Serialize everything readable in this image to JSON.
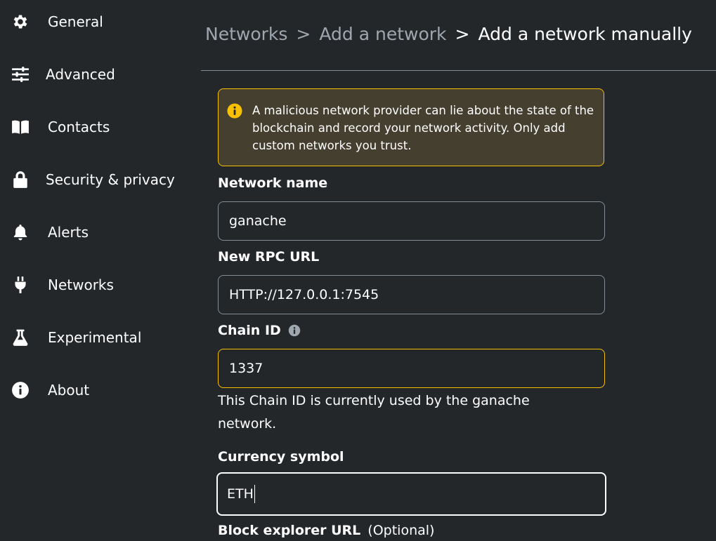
{
  "sidebar": {
    "items": [
      {
        "label": "General",
        "icon": "gear-icon"
      },
      {
        "label": "Advanced",
        "icon": "sliders-icon"
      },
      {
        "label": "Contacts",
        "icon": "book-icon"
      },
      {
        "label": "Security & privacy",
        "icon": "lock-icon"
      },
      {
        "label": "Alerts",
        "icon": "bell-icon"
      },
      {
        "label": "Networks",
        "icon": "plug-icon"
      },
      {
        "label": "Experimental",
        "icon": "flask-icon"
      },
      {
        "label": "About",
        "icon": "info-icon"
      }
    ]
  },
  "header": {
    "breadcrumb": {
      "networks": "Networks",
      "sep1": ">",
      "add_network": "Add a network",
      "sep2": ">",
      "current": "Add a network manually"
    }
  },
  "warning": {
    "text": "A malicious network provider can lie about the state of the blockchain and record your network activity. Only add custom networks you trust."
  },
  "form": {
    "network_name": {
      "label": "Network name",
      "value": "ganache"
    },
    "rpc_url": {
      "label": "New RPC URL",
      "value": "HTTP://127.0.0.1:7545"
    },
    "chain_id": {
      "label": "Chain ID",
      "value": "1337",
      "helper": "This Chain ID is currently used by the ganache network."
    },
    "currency_symbol": {
      "label": "Currency symbol",
      "value": "ETH"
    },
    "block_explorer": {
      "label": "Block explorer URL",
      "optional": "(Optional)"
    }
  },
  "colors": {
    "background": "#24272a",
    "warning_border": "#f8c000",
    "warning_bg": "#443f2f",
    "muted_text": "#9fa6ae",
    "input_border": "#848c96"
  }
}
